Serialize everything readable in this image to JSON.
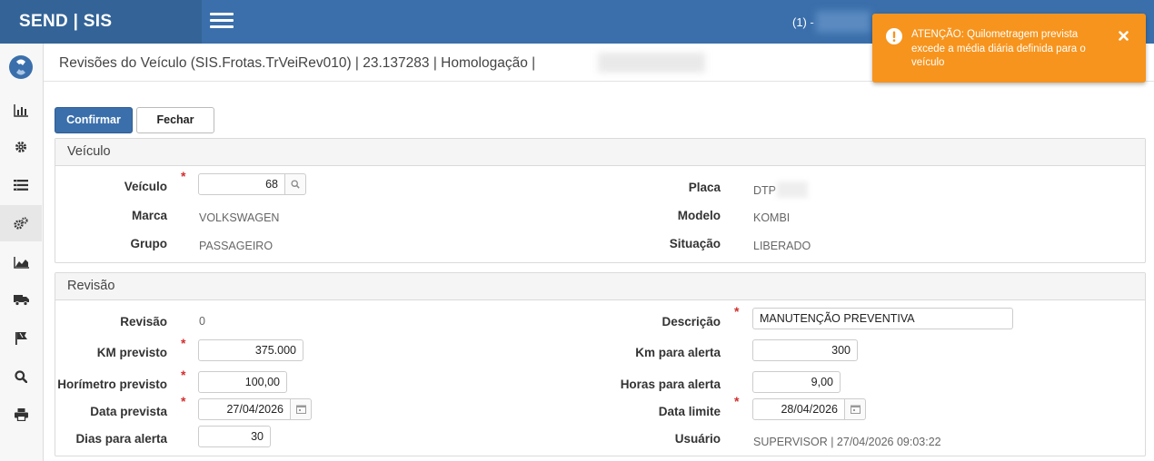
{
  "app": {
    "brand": "SEND | SIS",
    "user_prefix": "(1) -"
  },
  "page": {
    "title": "Revisões do Veículo (SIS.Frotas.TrVeiRev010) | 23.137283 | Homologação |"
  },
  "toolbar": {
    "confirm_label": "Confirmar",
    "close_label": "Fechar"
  },
  "veiculo_panel": {
    "title": "Veículo",
    "veiculo_label": "Veículo",
    "veiculo_value": "68",
    "placa_label": "Placa",
    "placa_value": "DTP",
    "marca_label": "Marca",
    "marca_value": "VOLKSWAGEN",
    "modelo_label": "Modelo",
    "modelo_value": "KOMBI",
    "grupo_label": "Grupo",
    "grupo_value": "PASSAGEIRO",
    "situacao_label": "Situação",
    "situacao_value": "LIBERADO"
  },
  "revisao_panel": {
    "title": "Revisão",
    "revisao_label": "Revisão",
    "revisao_value": "0",
    "descricao_label": "Descrição",
    "descricao_value": "MANUTENÇÃO PREVENTIVA",
    "km_previsto_label": "KM previsto",
    "km_previsto_value": "375.000",
    "km_alerta_label": "Km para alerta",
    "km_alerta_value": "300",
    "horimetro_label": "Horímetro previsto",
    "horimetro_value": "100,00",
    "horas_alerta_label": "Horas para alerta",
    "horas_alerta_value": "9,00",
    "data_prevista_label": "Data prevista",
    "data_prevista_value": "27/04/2026",
    "data_limite_label": "Data limite",
    "data_limite_value": "28/04/2026",
    "dias_alerta_label": "Dias para alerta",
    "dias_alerta_value": "30",
    "usuario_label": "Usuário",
    "usuario_value": "SUPERVISOR | 27/04/2026 09:03:22"
  },
  "toast": {
    "message": "ATENÇÃO: Quilometragem prevista excede a média diária definida para o veículo"
  },
  "colors": {
    "topbar": "#3a6fab",
    "brand_bg": "#346497",
    "toast": "#f7941d",
    "required": "#d32f2f"
  },
  "icons": [
    "menu-icon",
    "logo-icon",
    "chart-icon",
    "gear-icon",
    "list-icon",
    "gears-icon",
    "area-chart-icon",
    "truck-icon",
    "flag-icon",
    "search-icon",
    "print-icon",
    "warning-icon",
    "close-icon",
    "calendar-icon"
  ]
}
